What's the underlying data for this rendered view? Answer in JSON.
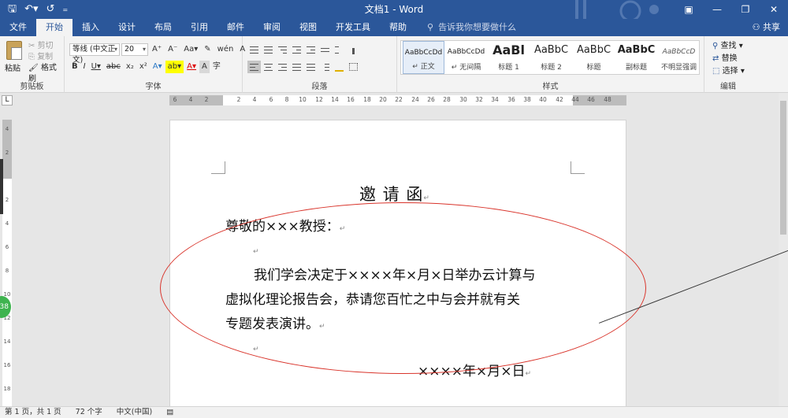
{
  "titlebar": {
    "doc_title": "文档1 - Word",
    "qat_icons": [
      "save-icon",
      "undo-icon",
      "redo-icon",
      "customize-icon"
    ],
    "qat_glyphs": [
      "🖫",
      "↶▾",
      "↺",
      "₌"
    ]
  },
  "tabs": [
    "文件",
    "开始",
    "插入",
    "设计",
    "布局",
    "引用",
    "邮件",
    "审阅",
    "视图",
    "开发工具",
    "帮助"
  ],
  "active_tab": "开始",
  "tell_me": "告诉我你想要做什么",
  "share": "共享",
  "ribbon": {
    "clipboard": {
      "paste": "粘贴",
      "cut": "剪切",
      "copy": "复制",
      "format_painter": "格式刷",
      "label": "剪贴板"
    },
    "font": {
      "font_name": "等线 (中文正文)",
      "font_size": "20",
      "label": "字体",
      "row1_tools": [
        "A⁺",
        "A⁻",
        "Aa▾",
        "✎",
        "wén",
        "A"
      ],
      "row2_tools": [
        "B",
        "I",
        "U▾",
        "abc",
        "x₂",
        "x²",
        "A▾",
        "ab▾",
        "A▾",
        "A",
        "字"
      ]
    },
    "paragraph": {
      "label": "段落"
    },
    "styles": {
      "label": "样式",
      "items": [
        {
          "preview": "AaBbCcDd",
          "name": "↵ 正文"
        },
        {
          "preview": "AaBbCcDd",
          "name": "↵ 无间隔"
        },
        {
          "preview": "AaBl",
          "name": "标题 1"
        },
        {
          "preview": "AaBbC",
          "name": "标题 2"
        },
        {
          "preview": "AaBbC",
          "name": "标题"
        },
        {
          "preview": "AaBbC",
          "name": "副标题"
        },
        {
          "preview": "AaBbCcD",
          "name": "不明显强调"
        }
      ]
    },
    "editing": {
      "find": "查找",
      "replace": "替换",
      "select": "选择",
      "label": "编辑"
    }
  },
  "ruler": {
    "h_numbers": [
      "6",
      "4",
      "2",
      "2",
      "4",
      "6",
      "8",
      "10",
      "12",
      "14",
      "16",
      "18",
      "20",
      "22",
      "24",
      "26",
      "28",
      "30",
      "32",
      "34",
      "36",
      "38",
      "40",
      "42",
      "44",
      "46",
      "48"
    ],
    "v_numbers": [
      "4",
      "2",
      "2",
      "4",
      "6",
      "8",
      "10",
      "12",
      "14",
      "16",
      "18"
    ],
    "bubble_text": "38"
  },
  "document": {
    "title": "邀 请 函",
    "salutation": "尊敬的×××教授：",
    "body_lines": [
      "我们学会决定于××××年×月×日举办云计算与",
      "虚拟化理论报告会，恭请您百忙之中与会并就有关",
      "专题发表演讲。"
    ],
    "date": "××××年×月×日",
    "paragraph_mark": "↵"
  },
  "status": {
    "page": "第 1 页，共 1 页",
    "words": "72 个字",
    "language": "中文(中国)"
  },
  "colors": {
    "brand": "#2b579a",
    "annotation": "#d9342b"
  }
}
